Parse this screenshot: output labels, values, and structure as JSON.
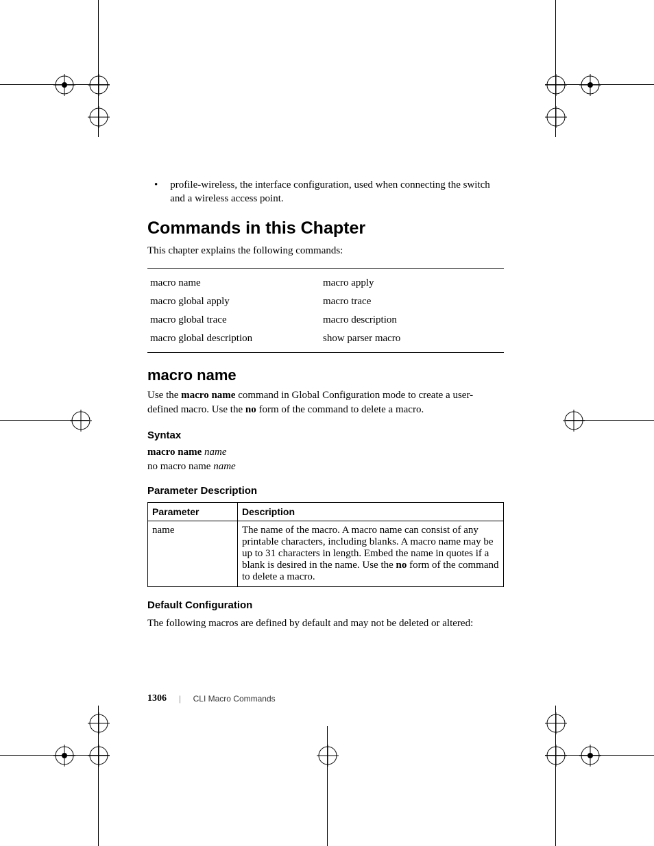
{
  "bullet": {
    "text": "profile-wireless, the interface configuration, used when connecting the switch and a wireless access point."
  },
  "h1": "Commands in this Chapter",
  "h1_intro": "This chapter explains the following commands:",
  "commands": [
    {
      "left": "macro name",
      "right": "macro apply"
    },
    {
      "left": "macro global apply",
      "right": "macro trace"
    },
    {
      "left": "macro global trace",
      "right": "macro description"
    },
    {
      "left": "macro global description",
      "right": "show parser macro"
    }
  ],
  "section": {
    "title": "macro name",
    "intro_pre": "Use the ",
    "intro_cmd": "macro name",
    "intro_mid": " command in Global Configuration mode to create a user-defined macro. Use the ",
    "intro_no": "no",
    "intro_post": " form of the command to delete a macro."
  },
  "syntax": {
    "heading": "Syntax",
    "line1_cmd": "macro name",
    "line1_arg": "name",
    "line2_pre": "no macro name ",
    "line2_arg": "name"
  },
  "param": {
    "heading": "Parameter Description",
    "col1": "Parameter",
    "col2": "Description",
    "row_param": "name",
    "row_desc_pre": "The name of the macro. A macro name can consist of any printable characters, including blanks. A macro name may be up to 31 characters in length. Embed the name in quotes if a blank is desired in the name. Use the ",
    "row_desc_no": "no",
    "row_desc_post": " form of the command to delete a macro."
  },
  "default": {
    "heading": "Default Configuration",
    "text": "The following macros are defined by default and may not be deleted or altered:"
  },
  "footer": {
    "page": "1306",
    "section": "CLI Macro Commands"
  }
}
